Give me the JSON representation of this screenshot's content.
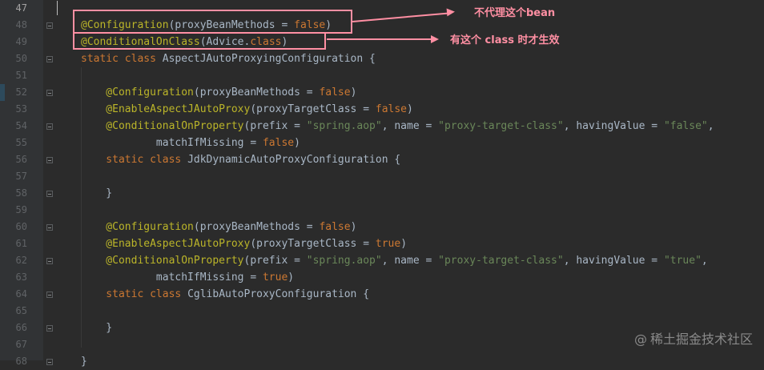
{
  "editor": {
    "line_numbers": [
      "47",
      "48",
      "49",
      "50",
      "51",
      "52",
      "53",
      "54",
      "55",
      "56",
      "57",
      "58",
      "59",
      "60",
      "61",
      "62",
      "63",
      "64",
      "65",
      "66",
      "67",
      "68"
    ],
    "current_line": "47",
    "lines": [
      [],
      [
        {
          "t": "@Configuration",
          "c": "ann"
        },
        {
          "t": "(proxyBeanMethods = ",
          "c": "p"
        },
        {
          "t": "false",
          "c": "kw"
        },
        {
          "t": ")",
          "c": "p"
        }
      ],
      [
        {
          "t": "@ConditionalOnClass",
          "c": "ann"
        },
        {
          "t": "(Advice.",
          "c": "p"
        },
        {
          "t": "class",
          "c": "kw"
        },
        {
          "t": ")",
          "c": "p"
        }
      ],
      [
        {
          "t": "static class ",
          "c": "kw"
        },
        {
          "t": "AspectJAutoProxyingConfiguration {",
          "c": "p"
        }
      ],
      [],
      [
        {
          "t": "    @Configuration",
          "c": "ann"
        },
        {
          "t": "(proxyBeanMethods = ",
          "c": "p"
        },
        {
          "t": "false",
          "c": "kw"
        },
        {
          "t": ")",
          "c": "p"
        }
      ],
      [
        {
          "t": "    @EnableAspectJAutoProxy",
          "c": "ann"
        },
        {
          "t": "(proxyTargetClass = ",
          "c": "p"
        },
        {
          "t": "false",
          "c": "kw"
        },
        {
          "t": ")",
          "c": "p"
        }
      ],
      [
        {
          "t": "    @ConditionalOnProperty",
          "c": "ann"
        },
        {
          "t": "(prefix = ",
          "c": "p"
        },
        {
          "t": "\"spring.aop\"",
          "c": "str"
        },
        {
          "t": ", name = ",
          "c": "p"
        },
        {
          "t": "\"proxy-target-class\"",
          "c": "str"
        },
        {
          "t": ", havingValue = ",
          "c": "p"
        },
        {
          "t": "\"false\"",
          "c": "str"
        },
        {
          "t": ",",
          "c": "p"
        }
      ],
      [
        {
          "t": "            matchIfMissing = ",
          "c": "p"
        },
        {
          "t": "false",
          "c": "kw"
        },
        {
          "t": ")",
          "c": "p"
        }
      ],
      [
        {
          "t": "    static class ",
          "c": "kw"
        },
        {
          "t": "JdkDynamicAutoProxyConfiguration {",
          "c": "p"
        }
      ],
      [],
      [
        {
          "t": "    }",
          "c": "p"
        }
      ],
      [],
      [
        {
          "t": "    @Configuration",
          "c": "ann"
        },
        {
          "t": "(proxyBeanMethods = ",
          "c": "p"
        },
        {
          "t": "false",
          "c": "kw"
        },
        {
          "t": ")",
          "c": "p"
        }
      ],
      [
        {
          "t": "    @EnableAspectJAutoProxy",
          "c": "ann"
        },
        {
          "t": "(proxyTargetClass = ",
          "c": "p"
        },
        {
          "t": "true",
          "c": "kw"
        },
        {
          "t": ")",
          "c": "p"
        }
      ],
      [
        {
          "t": "    @ConditionalOnProperty",
          "c": "ann"
        },
        {
          "t": "(prefix = ",
          "c": "p"
        },
        {
          "t": "\"spring.aop\"",
          "c": "str"
        },
        {
          "t": ", name = ",
          "c": "p"
        },
        {
          "t": "\"proxy-target-class\"",
          "c": "str"
        },
        {
          "t": ", havingValue = ",
          "c": "p"
        },
        {
          "t": "\"true\"",
          "c": "str"
        },
        {
          "t": ",",
          "c": "p"
        }
      ],
      [
        {
          "t": "            matchIfMissing = ",
          "c": "p"
        },
        {
          "t": "true",
          "c": "kw"
        },
        {
          "t": ")",
          "c": "p"
        }
      ],
      [
        {
          "t": "    static class ",
          "c": "kw"
        },
        {
          "t": "CglibAutoProxyConfiguration {",
          "c": "p"
        }
      ],
      [],
      [
        {
          "t": "    }",
          "c": "p"
        }
      ],
      [],
      [
        {
          "t": "}",
          "c": "p"
        }
      ]
    ]
  },
  "annotations": {
    "callout_1": "不代理这个bean",
    "callout_2": "有这个 class 时才生效"
  },
  "watermark": "稀土掘金技术社区",
  "colors": {
    "background": "#2b2b2b",
    "annotation": "#bbb529",
    "keyword": "#cc7832",
    "string": "#6a8759",
    "plain": "#a9b7c6",
    "callout": "#ff8fa3"
  }
}
